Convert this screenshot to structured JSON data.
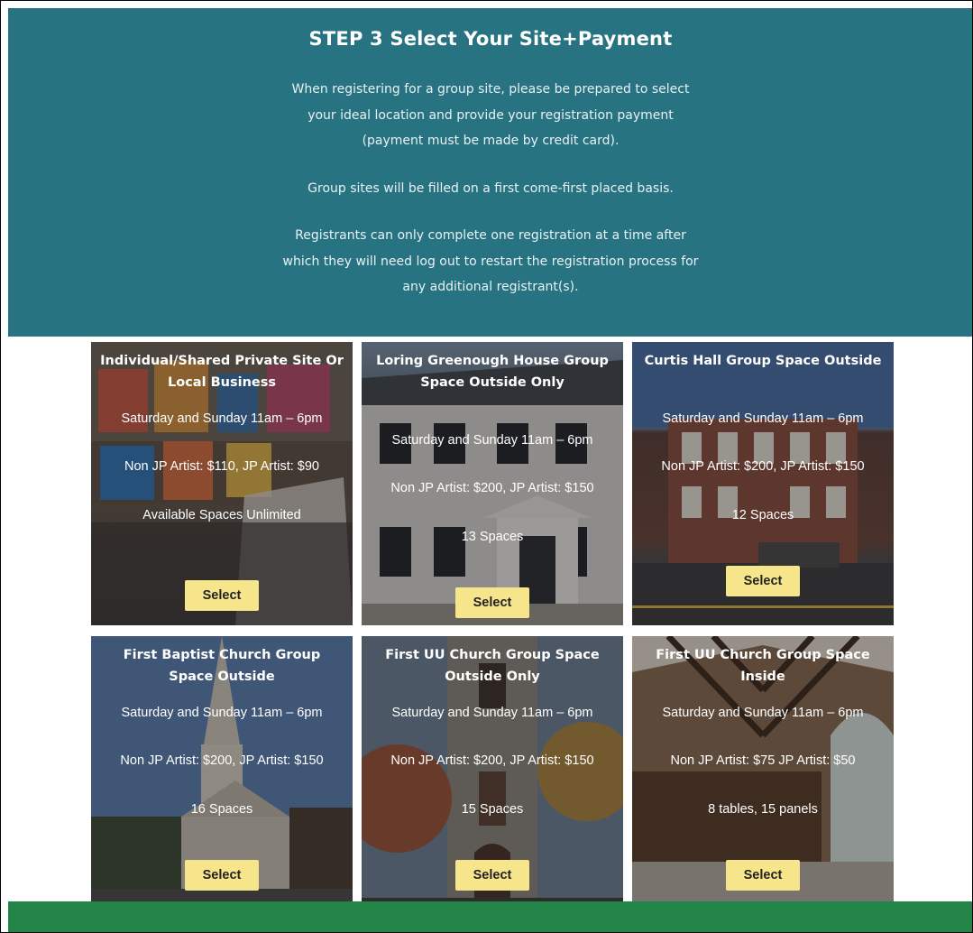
{
  "header": {
    "title": "STEP 3 Select Your Site+Payment",
    "paragraphs": [
      "When registering for a group site, please be prepared to select your ideal location and provide your registration payment (payment must be made by credit card).",
      "Group sites will be filled on a first come-first placed basis.",
      "Registrants can only complete one registration at a time after which they will need log out to restart the registration process for any additional registrant(s)."
    ]
  },
  "cards": [
    {
      "title": "Individual/Shared Private Site Or Local Business",
      "hours": "Saturday and Sunday 11am – 6pm",
      "price": "Non JP Artist: $110, JP Artist: $90",
      "spaces": "Available Spaces Unlimited",
      "button": "Select"
    },
    {
      "title": "Loring Greenough House Group Space Outside Only",
      "hours": "Saturday and Sunday 11am – 6pm",
      "price": "Non JP Artist: $200, JP Artist: $150",
      "spaces": "13 Spaces",
      "button": "Select"
    },
    {
      "title": "Curtis Hall Group Space Outside",
      "hours": "Saturday and Sunday 11am – 6pm",
      "price": "Non JP Artist: $200, JP Artist: $150",
      "spaces": "12 Spaces",
      "button": "Select"
    },
    {
      "title": "First Baptist Church Group Space Outside",
      "hours": "Saturday and Sunday 11am – 6pm",
      "price": "Non JP Artist: $200, JP Artist: $150",
      "spaces": "16 Spaces",
      "button": "Select"
    },
    {
      "title": "First UU Church Group Space Outside Only",
      "hours": "Saturday and Sunday 11am – 6pm",
      "price": "Non JP Artist: $200, JP Artist: $150",
      "spaces": "15 Spaces",
      "button": "Select"
    },
    {
      "title": "First UU Church Group Space Inside",
      "hours": "Saturday and Sunday 11am – 6pm",
      "price": "Non JP Artist: $75 JP Artist: $50",
      "spaces": "8 tables, 15 panels",
      "button": "Select"
    }
  ],
  "colors": {
    "header_bg": "#277382",
    "button_bg": "#f6e58a",
    "footer_bg": "#228547"
  }
}
